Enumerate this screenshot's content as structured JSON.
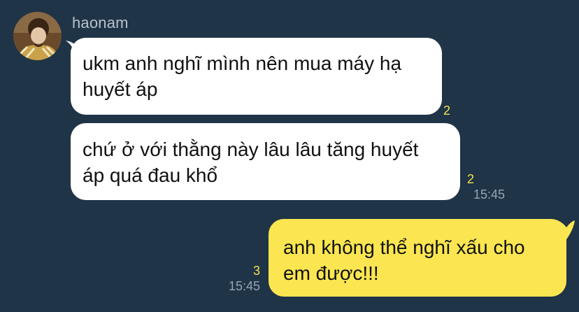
{
  "chat": {
    "sender_name": "haonam",
    "messages": [
      {
        "direction": "incoming",
        "text_lines": [
          "ukm anh nghĩ mình nên mua máy hạ",
          "huyết áp"
        ],
        "unread_count": "2",
        "time": ""
      },
      {
        "direction": "incoming",
        "text_lines": [
          "chứ ở với thằng này lâu lâu tăng huyết",
          "áp quá đau khổ"
        ],
        "unread_count": "2",
        "time": "15:45"
      },
      {
        "direction": "outgoing",
        "text_lines": [
          "anh không thể nghĩ xấu cho",
          "em được!!!"
        ],
        "unread_count": "3",
        "time": "15:45"
      }
    ]
  },
  "colors": {
    "background": "#1f3447",
    "incoming_bubble": "#ffffff",
    "outgoing_bubble": "#fbe651",
    "unread_count": "#f2e14c",
    "timestamp": "#97a5b2",
    "sender_name": "#b9c2cc"
  },
  "icons": {
    "avatar": "profile-photo"
  }
}
